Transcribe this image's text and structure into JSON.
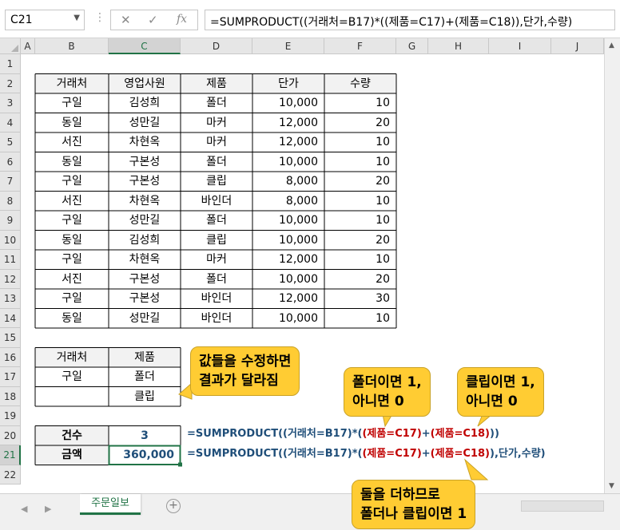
{
  "formula_bar": {
    "name_box": "C21",
    "fx_label": "fx",
    "formula": "=SUMPRODUCT((거래처=B17)*((제품=C17)+(제품=C18)),단가,수량)"
  },
  "columns": [
    "A",
    "B",
    "C",
    "D",
    "E",
    "F",
    "G",
    "H",
    "I",
    "J"
  ],
  "rows": [
    "1",
    "2",
    "3",
    "4",
    "5",
    "6",
    "7",
    "8",
    "9",
    "10",
    "11",
    "12",
    "13",
    "14",
    "15",
    "16",
    "17",
    "18",
    "19",
    "20",
    "21",
    "22"
  ],
  "main_table": {
    "headers": [
      "거래처",
      "영업사원",
      "제품",
      "단가",
      "수량"
    ],
    "rows": [
      [
        "구일",
        "김성희",
        "폴더",
        "10,000",
        "10"
      ],
      [
        "동일",
        "성만길",
        "마커",
        "12,000",
        "20"
      ],
      [
        "서진",
        "차현옥",
        "마커",
        "12,000",
        "10"
      ],
      [
        "동일",
        "구본성",
        "폴더",
        "10,000",
        "10"
      ],
      [
        "구일",
        "구본성",
        "클립",
        "8,000",
        "20"
      ],
      [
        "서진",
        "차현옥",
        "바인더",
        "8,000",
        "10"
      ],
      [
        "구일",
        "성만길",
        "폴더",
        "10,000",
        "10"
      ],
      [
        "동일",
        "김성희",
        "클립",
        "10,000",
        "20"
      ],
      [
        "구일",
        "차현옥",
        "마커",
        "12,000",
        "10"
      ],
      [
        "서진",
        "구본성",
        "폴더",
        "10,000",
        "20"
      ],
      [
        "구일",
        "구본성",
        "바인더",
        "12,000",
        "30"
      ],
      [
        "동일",
        "성만길",
        "바인더",
        "10,000",
        "10"
      ]
    ]
  },
  "criteria_table": {
    "headers": [
      "거래처",
      "제품"
    ],
    "rows": [
      [
        "구일",
        "폴더"
      ],
      [
        "",
        "클립"
      ]
    ]
  },
  "result_table": {
    "rows": [
      {
        "label": "건수",
        "value": "3"
      },
      {
        "label": "금액",
        "value": "360,000"
      }
    ]
  },
  "formulas": {
    "count": {
      "a": "=SUMPRODUCT((거래처=B17)*(",
      "b": "(제품=C17)",
      "c": "+",
      "d": "(제품=C18)",
      "e": "))"
    },
    "amount": {
      "a": "=SUMPRODUCT((거래처=B17)*(",
      "b": "(제품=C17)",
      "c": "+",
      "d": "(제품=C18)",
      "e": "),단가,수량)"
    }
  },
  "callouts": {
    "edit_values": [
      "값들을 수정하면",
      "결과가 달라짐"
    ],
    "folder": [
      "폴더이면 1,",
      "아니면 0"
    ],
    "clip": [
      "클립이면 1,",
      "아니면 0"
    ],
    "sum": [
      "둘을 더하므로",
      "폴더나 클립이면 1"
    ]
  },
  "sheet_tab": "주문일보",
  "colors": {
    "accent": "#217346",
    "callout": "#ffcc33",
    "formula_blue": "#1f4e79",
    "formula_red": "#c00000"
  }
}
